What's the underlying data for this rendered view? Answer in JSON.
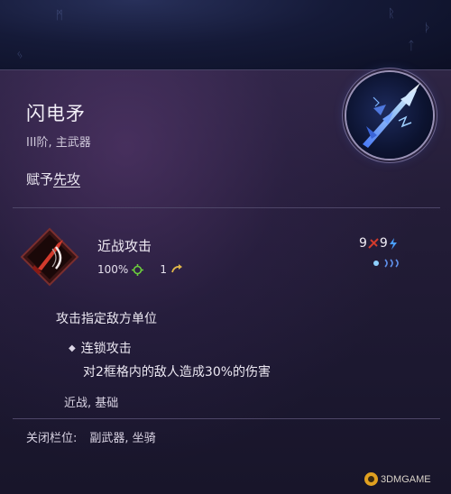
{
  "item": {
    "name": "闪电矛",
    "tier_type": "III阶, 主武器",
    "grant_prefix": "赋予",
    "grant_keyword": "先攻"
  },
  "skill": {
    "name": "近战攻击",
    "accuracy": "100%",
    "cooldown": "1",
    "cost_a": "9",
    "cost_b": "9",
    "description": "攻击指定敌方单位",
    "effect_title": "连锁攻击",
    "effect_desc": "对2框格内的敌人造成30%的伤害",
    "tags": "近战, 基础"
  },
  "slots": {
    "label": "关闭栏位:",
    "value": "副武器, 坐骑"
  },
  "watermark": {
    "text": "3DMGAME"
  },
  "icons": {
    "accuracy": "crosshair-icon",
    "cooldown": "hourglass-arrow-icon",
    "cost_a": "red-slash-icon",
    "cost_b": "blue-lightning-icon",
    "range": "range-waves-icon",
    "emblem": "lightning-spear-icon",
    "skill": "melee-attack-icon"
  },
  "colors": {
    "panel": "#241d38",
    "accent_red": "#d23a2c",
    "accent_blue": "#4aa0ff",
    "accent_gold": "#e0a020"
  }
}
